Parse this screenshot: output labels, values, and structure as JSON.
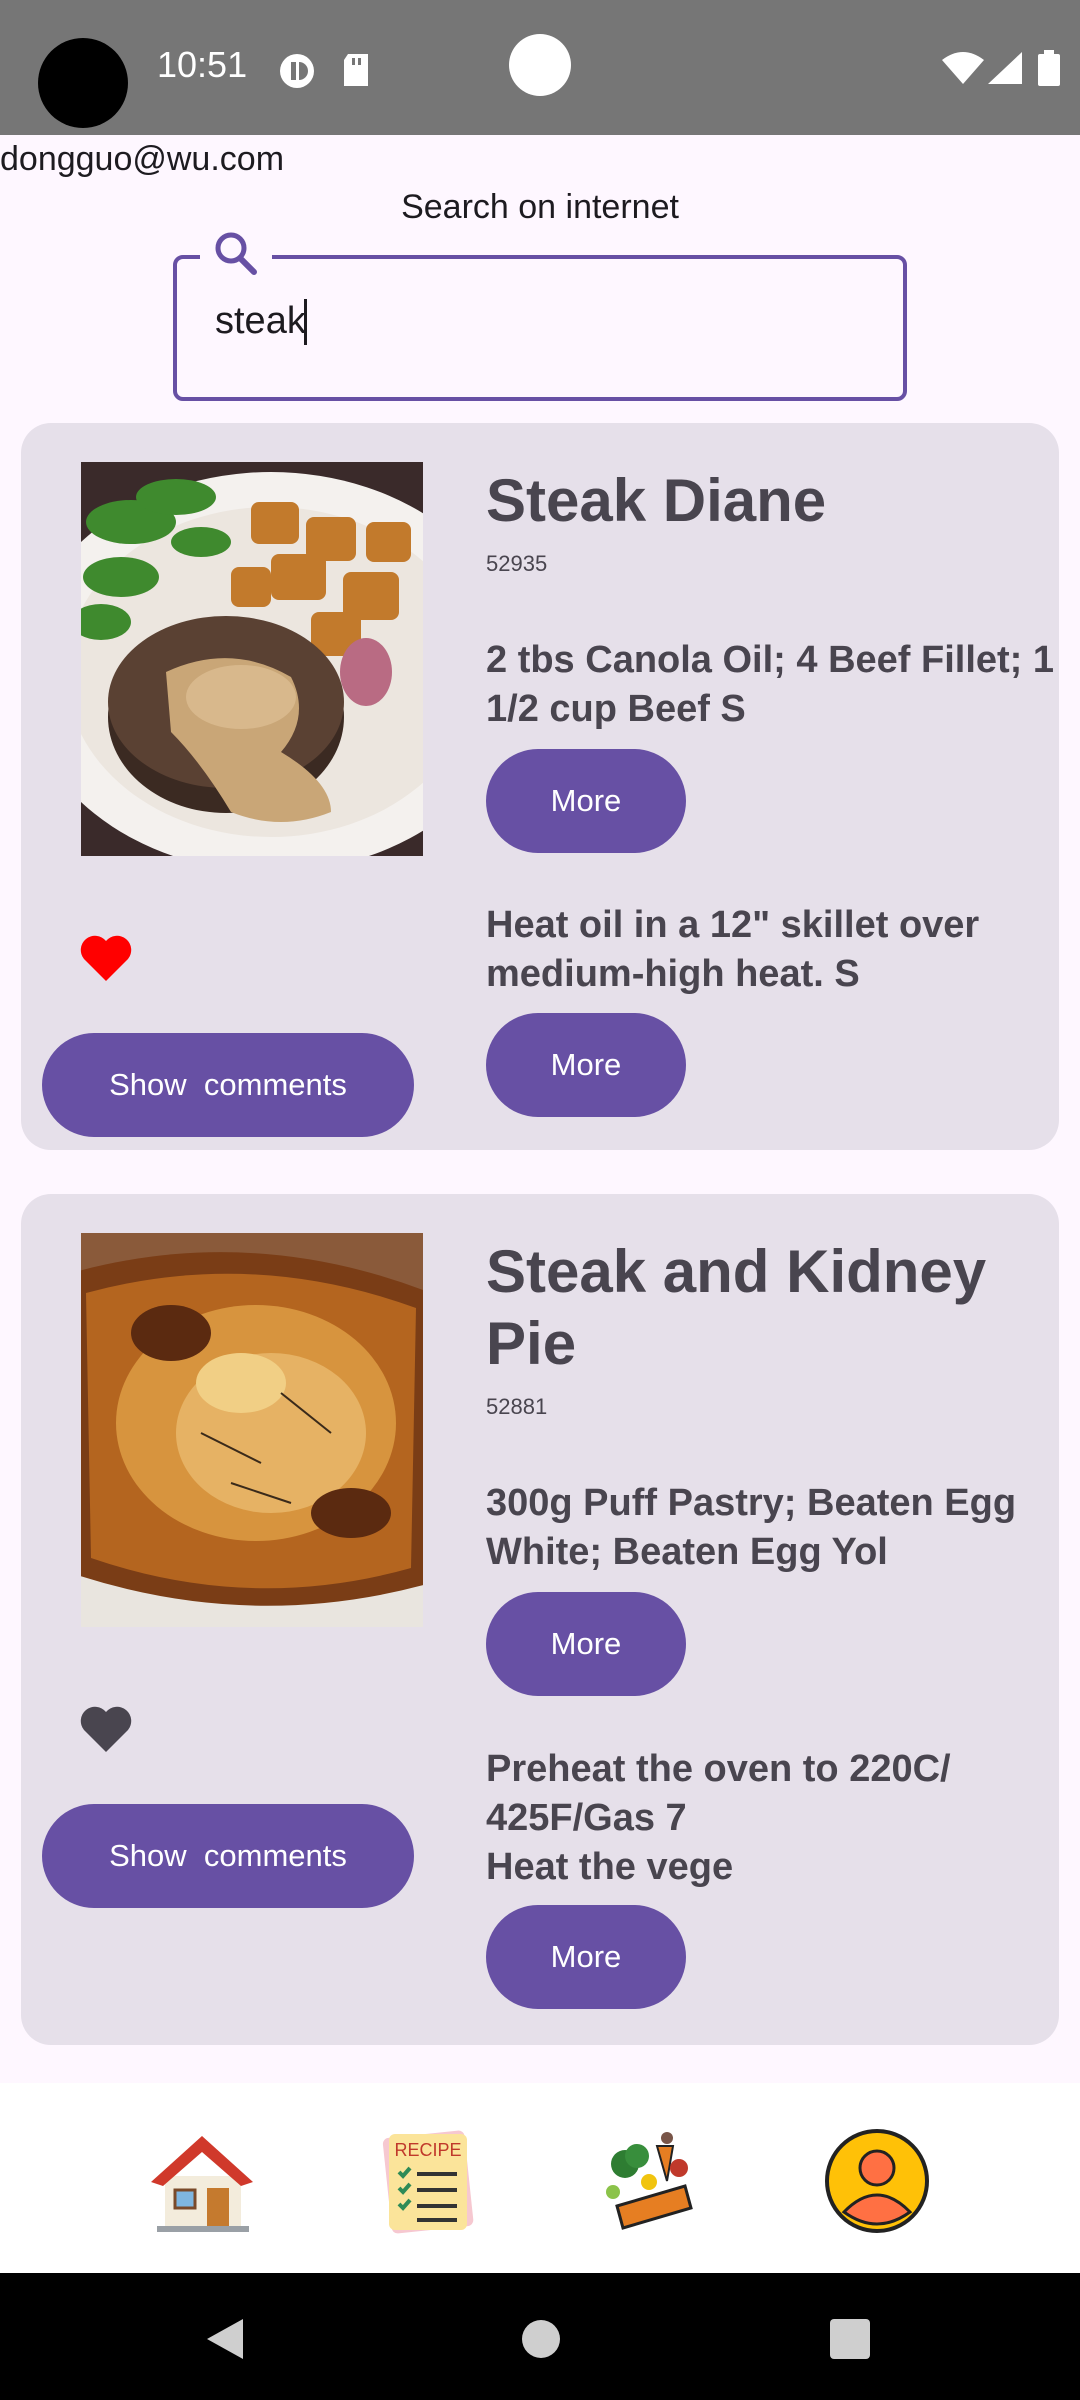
{
  "status_bar": {
    "time": "10:51"
  },
  "user": {
    "email": "dongguo@wu.com"
  },
  "search": {
    "label": "Search on internet",
    "value": "steak"
  },
  "recipes": [
    {
      "title": "Steak Diane",
      "id": "52935",
      "ingredients": "2 tbs Canola Oil; 4 Beef Fillet; 1 1/2 cup  Beef S",
      "instructions": "Heat oil in a 12\" skillet over medium-high heat. S",
      "more_label": "More",
      "comments_label": "Show  comments",
      "favorite": true
    },
    {
      "title": "Steak and Kidney Pie",
      "id": "52881",
      "ingredients": "300g Puff Pastry; Beaten Egg White; Beaten Egg Yol",
      "instructions": "Preheat the oven to 220C/\n425F/Gas 7\nHeat the vege",
      "more_label": "More",
      "comments_label": "Show  comments",
      "favorite": false
    }
  ],
  "bottom_nav": [
    {
      "icon": "home-icon"
    },
    {
      "icon": "recipe-icon",
      "text": "RECIPE"
    },
    {
      "icon": "ingredients-icon"
    },
    {
      "icon": "profile-icon"
    }
  ],
  "colors": {
    "accent": "#6750A4",
    "card": "#E6E0EA",
    "favorite": "#FF0000",
    "heart_inactive": "#49454F"
  }
}
